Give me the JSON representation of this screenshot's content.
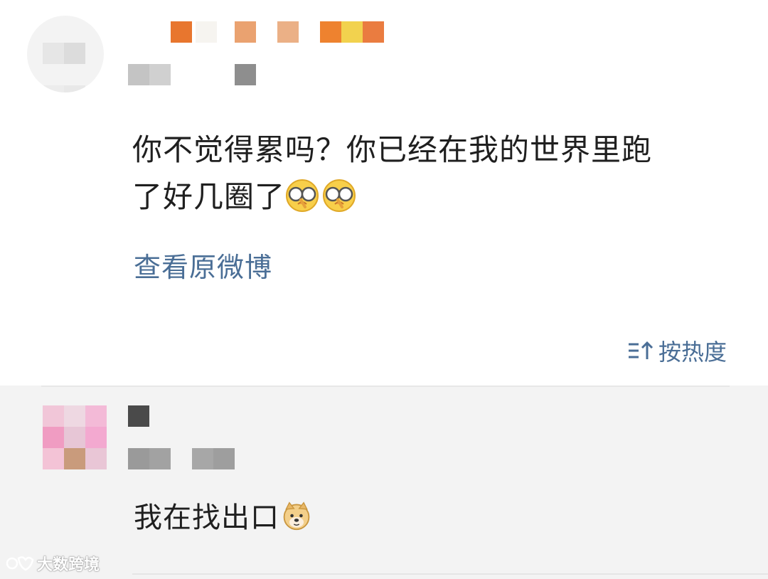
{
  "post": {
    "text_line1": "你不觉得累吗？你已经在我的世界里跑",
    "text_line2": "了好几圈了",
    "emoji_names": [
      "glasses-emoji",
      "glasses-emoji"
    ],
    "view_original_label": "查看原微博"
  },
  "sort": {
    "label": "按热度",
    "icon": "sort-icon"
  },
  "comment": {
    "text": "我在找出口",
    "emoji": "doge-emoji"
  },
  "watermark": {
    "text": "大数跨境"
  },
  "colors": {
    "link": "#4a6e96",
    "comment_bg": "#f3f3f3"
  }
}
